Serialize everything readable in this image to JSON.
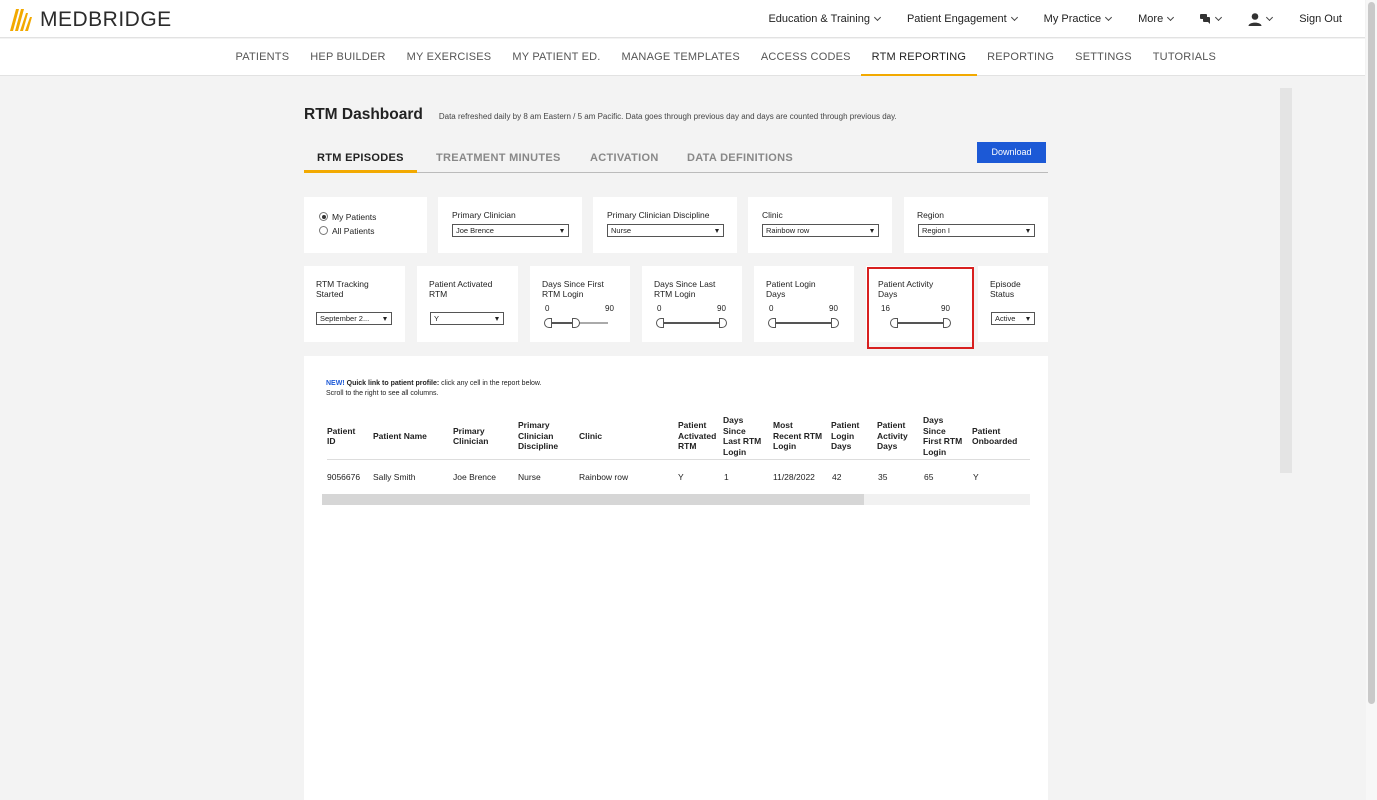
{
  "brand": {
    "name": "MEDBRIDGE",
    "logo_color": "#f2a900"
  },
  "topnav": {
    "education": "Education & Training",
    "engagement": "Patient Engagement",
    "practice": "My Practice",
    "more": "More",
    "signout": "Sign Out"
  },
  "subnav": [
    "PATIENTS",
    "HEP BUILDER",
    "MY EXERCISES",
    "MY PATIENT ED.",
    "MANAGE TEMPLATES",
    "ACCESS CODES",
    "RTM REPORTING",
    "REPORTING",
    "SETTINGS",
    "TUTORIALS"
  ],
  "subnav_active": "RTM REPORTING",
  "dashboard": {
    "title": "RTM Dashboard",
    "refresh_note": "Data refreshed daily by 8 am Eastern / 5 am Pacific. Data goes through previous day and days are counted through previous day.",
    "tabs": [
      "RTM EPISODES",
      "TREATMENT MINUTES",
      "ACTIVATION",
      "DATA DEFINITIONS"
    ],
    "active_tab": "RTM EPISODES",
    "download_label": "Download"
  },
  "filters": {
    "scope": {
      "options": [
        "My Patients",
        "All Patients"
      ],
      "selected": "My Patients"
    },
    "primary_clinician": {
      "label": "Primary Clinician",
      "value": "Joe Brence"
    },
    "discipline": {
      "label": "Primary Clinician Discipline",
      "value": "Nurse"
    },
    "clinic": {
      "label": "Clinic",
      "value": "Rainbow row"
    },
    "region": {
      "label": "Region",
      "value": "Region I"
    },
    "tracking_started": {
      "label_1": "RTM Tracking",
      "label_2": "Started",
      "value": "September 2..."
    },
    "activated": {
      "label_1": "Patient Activated",
      "label_2": "RTM",
      "value": "Y"
    },
    "days_first_login": {
      "label_1": "Days Since First",
      "label_2": "RTM Login",
      "min": "0",
      "max": "90"
    },
    "days_last_login": {
      "label_1": "Days Since Last",
      "label_2": "RTM Login",
      "min": "0",
      "max": "90"
    },
    "login_days": {
      "label_1": "Patient Login",
      "label_2": "Days",
      "min": "0",
      "max": "90"
    },
    "activity_days": {
      "label_1": "Patient Activity",
      "label_2": "Days",
      "min": "16",
      "max": "90"
    },
    "episode_status": {
      "label_1": "Episode",
      "label_2": "Status",
      "value": "Active"
    }
  },
  "report": {
    "note_new": "NEW!",
    "note_bold": "Quick link to patient profile:",
    "note_rest": "click any cell in the report below.",
    "note_line2": "Scroll to the right to see all columns.",
    "columns": [
      [
        "Patient",
        "ID"
      ],
      [
        "Patient Name"
      ],
      [
        "Primary",
        "Clinician"
      ],
      [
        "Primary",
        "Clinician",
        "Discipline"
      ],
      [
        "Clinic"
      ],
      [
        "Patient",
        "Activated",
        "RTM"
      ],
      [
        "Days",
        "Since",
        "Last RTM",
        "Login"
      ],
      [
        "Most",
        "Recent RTM",
        "Login"
      ],
      [
        "Patient",
        "Login",
        "Days"
      ],
      [
        "Patient",
        "Activity",
        "Days"
      ],
      [
        "Days",
        "Since",
        "First RTM",
        "Login"
      ],
      [
        "Patient",
        "Onboarded"
      ]
    ],
    "rows": [
      [
        "9056676",
        "Sally Smith",
        "Joe Brence",
        "Nurse",
        "Rainbow row",
        "Y",
        "1",
        "11/28/2022",
        "42",
        "35",
        "65",
        "Y"
      ]
    ]
  },
  "colors": {
    "accent": "#f2a900",
    "primary_button": "#1c59d6",
    "highlight": "#d8201f"
  }
}
